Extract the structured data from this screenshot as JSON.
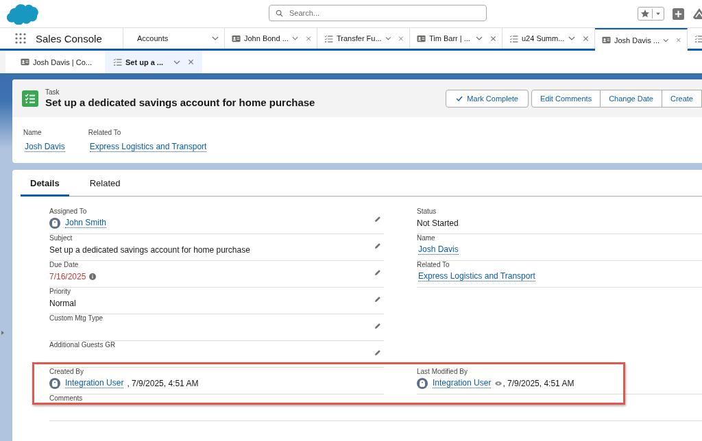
{
  "header": {
    "search": {
      "placeholder": "Search..."
    }
  },
  "nav": {
    "app_name": "Sales Console",
    "tabs": [
      {
        "label": "Accounts",
        "kind": "object",
        "selected": false,
        "closable": false
      },
      {
        "label": "John Bond ...",
        "kind": "contact",
        "selected": false,
        "closable": true
      },
      {
        "label": "Transfer Fu...",
        "kind": "task",
        "selected": false,
        "closable": true
      },
      {
        "label": "Tim Barr | ...",
        "kind": "contact",
        "selected": false,
        "closable": true
      },
      {
        "label": "u24 Summ...",
        "kind": "task",
        "selected": false,
        "closable": true
      },
      {
        "label": "Josh Davis ...",
        "kind": "contact",
        "selected": true,
        "closable": true
      },
      {
        "kind": "task",
        "selected": false
      }
    ]
  },
  "subtabs": [
    {
      "label": "Josh Davis | Co...",
      "kind": "contact",
      "selected": false,
      "closable": false
    },
    {
      "label": "Set up a ...",
      "kind": "task",
      "selected": true,
      "closable": true
    }
  ],
  "record": {
    "object_type": "Task",
    "title": "Set up a dedicated savings account for home purchase",
    "actions": [
      {
        "label": "Mark Complete",
        "kind": "check"
      },
      {
        "label": "Edit Comments",
        "kind": "group"
      },
      {
        "label": "Change Date",
        "kind": "group"
      },
      {
        "label": "Create",
        "kind": "group"
      }
    ],
    "highlights": [
      {
        "label": "Name",
        "value": "Josh Davis"
      },
      {
        "label": "Related To",
        "value": "Express Logistics and Transport"
      }
    ]
  },
  "detail_tabs": [
    {
      "label": "Details",
      "selected": true
    },
    {
      "label": "Related",
      "selected": false
    }
  ],
  "fields": [
    {
      "left": {
        "label": "Assigned To",
        "kind": "user",
        "value": "John Smith",
        "editable": true
      },
      "right": {
        "label": "Status",
        "kind": "text",
        "value": "Not Started",
        "editable": false
      }
    },
    {
      "left": {
        "label": "Subject",
        "kind": "text",
        "value": "Set up a dedicated savings account for home purchase",
        "editable": true
      },
      "right": {
        "label": "Name",
        "kind": "link",
        "value": "Josh Davis",
        "editable": false
      }
    },
    {
      "left": {
        "label": "Due Date",
        "kind": "date",
        "value": "7/16/2025",
        "overdue": true,
        "editable": true
      },
      "right": {
        "label": "Related To",
        "kind": "link",
        "value": "Express Logistics and Transport",
        "editable": false
      }
    },
    {
      "left": {
        "label": "Priority",
        "kind": "text",
        "value": "Normal",
        "editable": true
      }
    },
    {
      "left": {
        "label": "Custom Mtg Type",
        "kind": "empty",
        "editable": true
      }
    },
    {
      "left": {
        "label": "Additional Guests GR",
        "kind": "empty",
        "editable": true
      }
    },
    {
      "highlighted": true,
      "left": {
        "label": "Created By",
        "kind": "audit",
        "value": "Integration User",
        "timestamp": ", 7/9/2025, 4:51 AM",
        "preview": false,
        "editable": false
      },
      "right": {
        "label": "Last Modified By",
        "kind": "audit",
        "value": "Integration User",
        "timestamp": ", 7/9/2025, 4:51 AM",
        "preview": true,
        "editable": false
      }
    },
    {
      "wide": true,
      "left": {
        "label": "Comments",
        "kind": "empty",
        "editable": false
      }
    }
  ]
}
